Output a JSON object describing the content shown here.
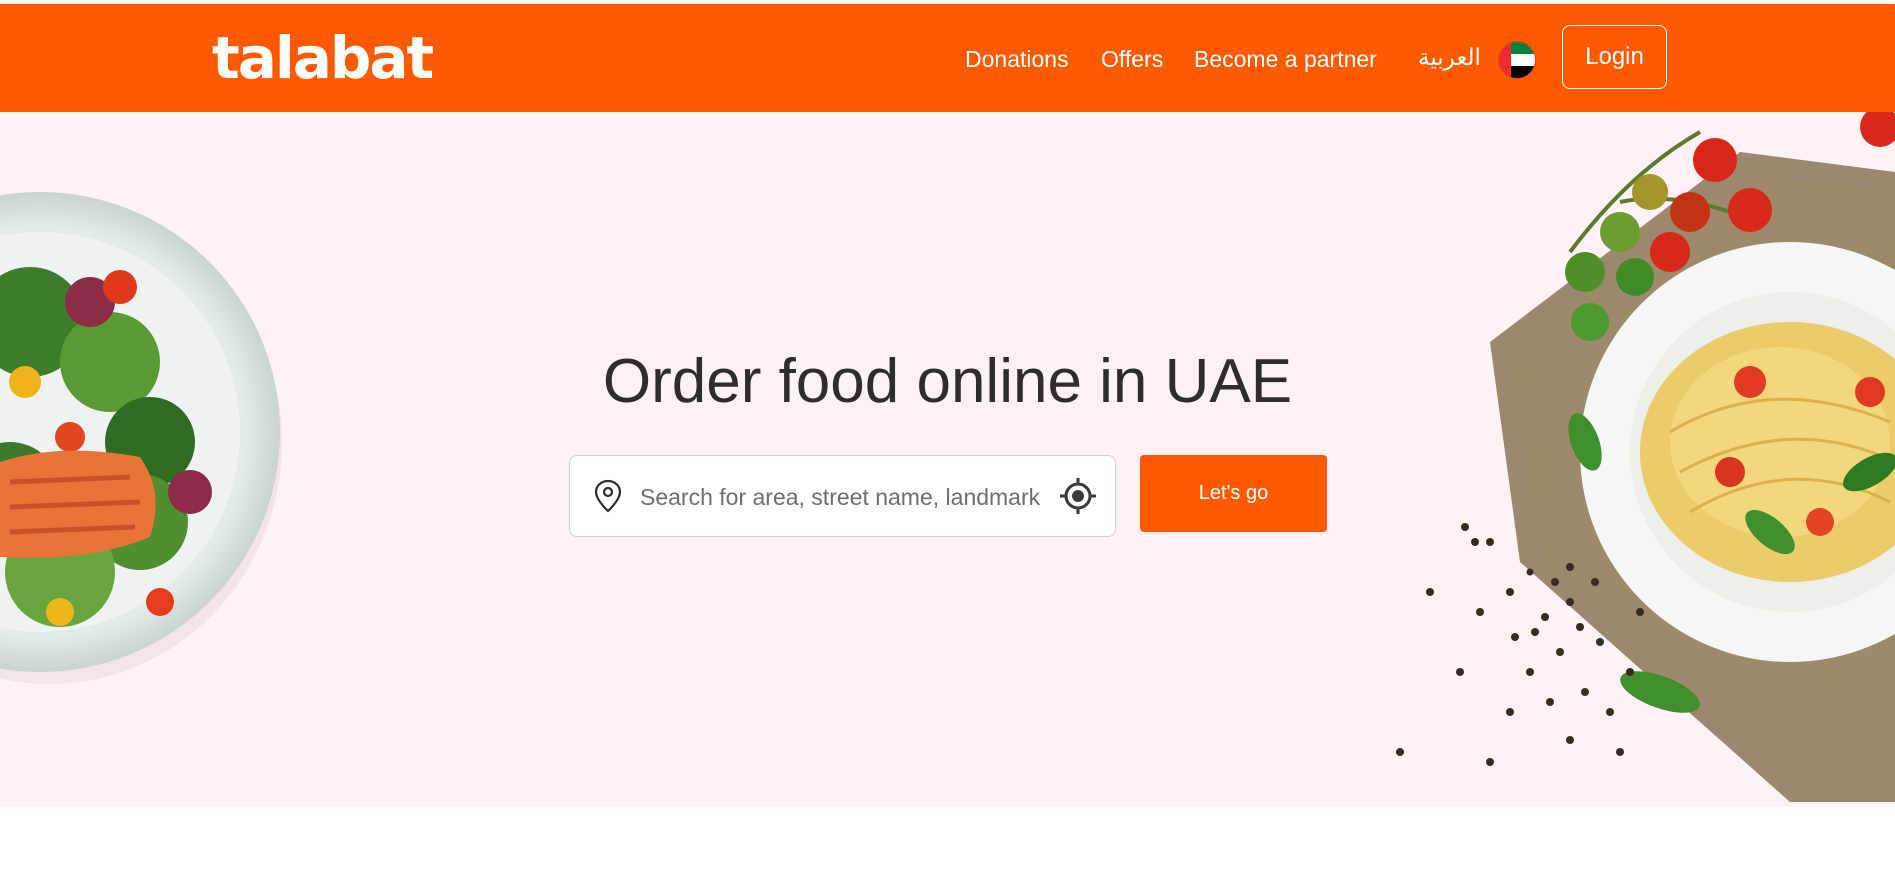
{
  "navbar": {
    "logo": "talabat",
    "links": [
      {
        "label": "Donations"
      },
      {
        "label": "Offers"
      },
      {
        "label": "Become a partner"
      },
      {
        "label": "العربية"
      }
    ],
    "flag_icon": "uae-flag-icon",
    "login_label": "Login"
  },
  "hero": {
    "headline": "Order food online in UAE",
    "search": {
      "placeholder": "Search for area, street name, landmark...",
      "pin_icon": "location-pin-icon",
      "locate_icon": "locate-me-icon"
    },
    "cta_label": "Let's go",
    "left_image": "salmon-salad-plate",
    "right_image": "spaghetti-plate-with-tomatoes"
  },
  "colors": {
    "brand": "#ff5a00",
    "hero_background": "#fff1f4",
    "headline": "#2d2d2d"
  }
}
